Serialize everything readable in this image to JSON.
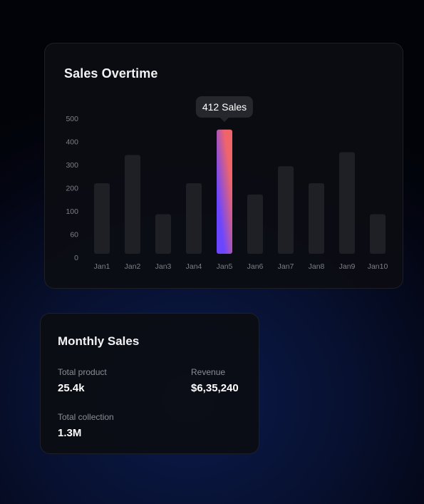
{
  "sales_chart": {
    "title": "Sales Overtime",
    "tooltip": "412 Sales",
    "highlight_color_top": "#f0656a",
    "highlight_color_bottom": "#6b46ff",
    "bar_color": "#1f2026"
  },
  "chart_data": {
    "type": "bar",
    "title": "Sales Overtime",
    "categories": [
      "Jan1",
      "Jan2",
      "Jan3",
      "Jan4",
      "Jan5",
      "Jan6",
      "Jan7",
      "Jan8",
      "Jan9",
      "Jan10"
    ],
    "values": [
      250,
      350,
      140,
      250,
      440,
      210,
      310,
      250,
      360,
      140
    ],
    "y_ticks": [
      "0",
      "60",
      "100",
      "200",
      "300",
      "400",
      "500"
    ],
    "ylim": [
      0,
      500
    ],
    "highlighted_category": "Jan5",
    "highlight_label": "412 Sales",
    "grid": false
  },
  "monthly_sales": {
    "title": "Monthly Sales",
    "total_product_label": "Total product",
    "total_product_value": "25.4k",
    "revenue_label": "Revenue",
    "revenue_value": "$6,35,240",
    "total_collection_label": "Total collection",
    "total_collection_value": "1.3M"
  }
}
